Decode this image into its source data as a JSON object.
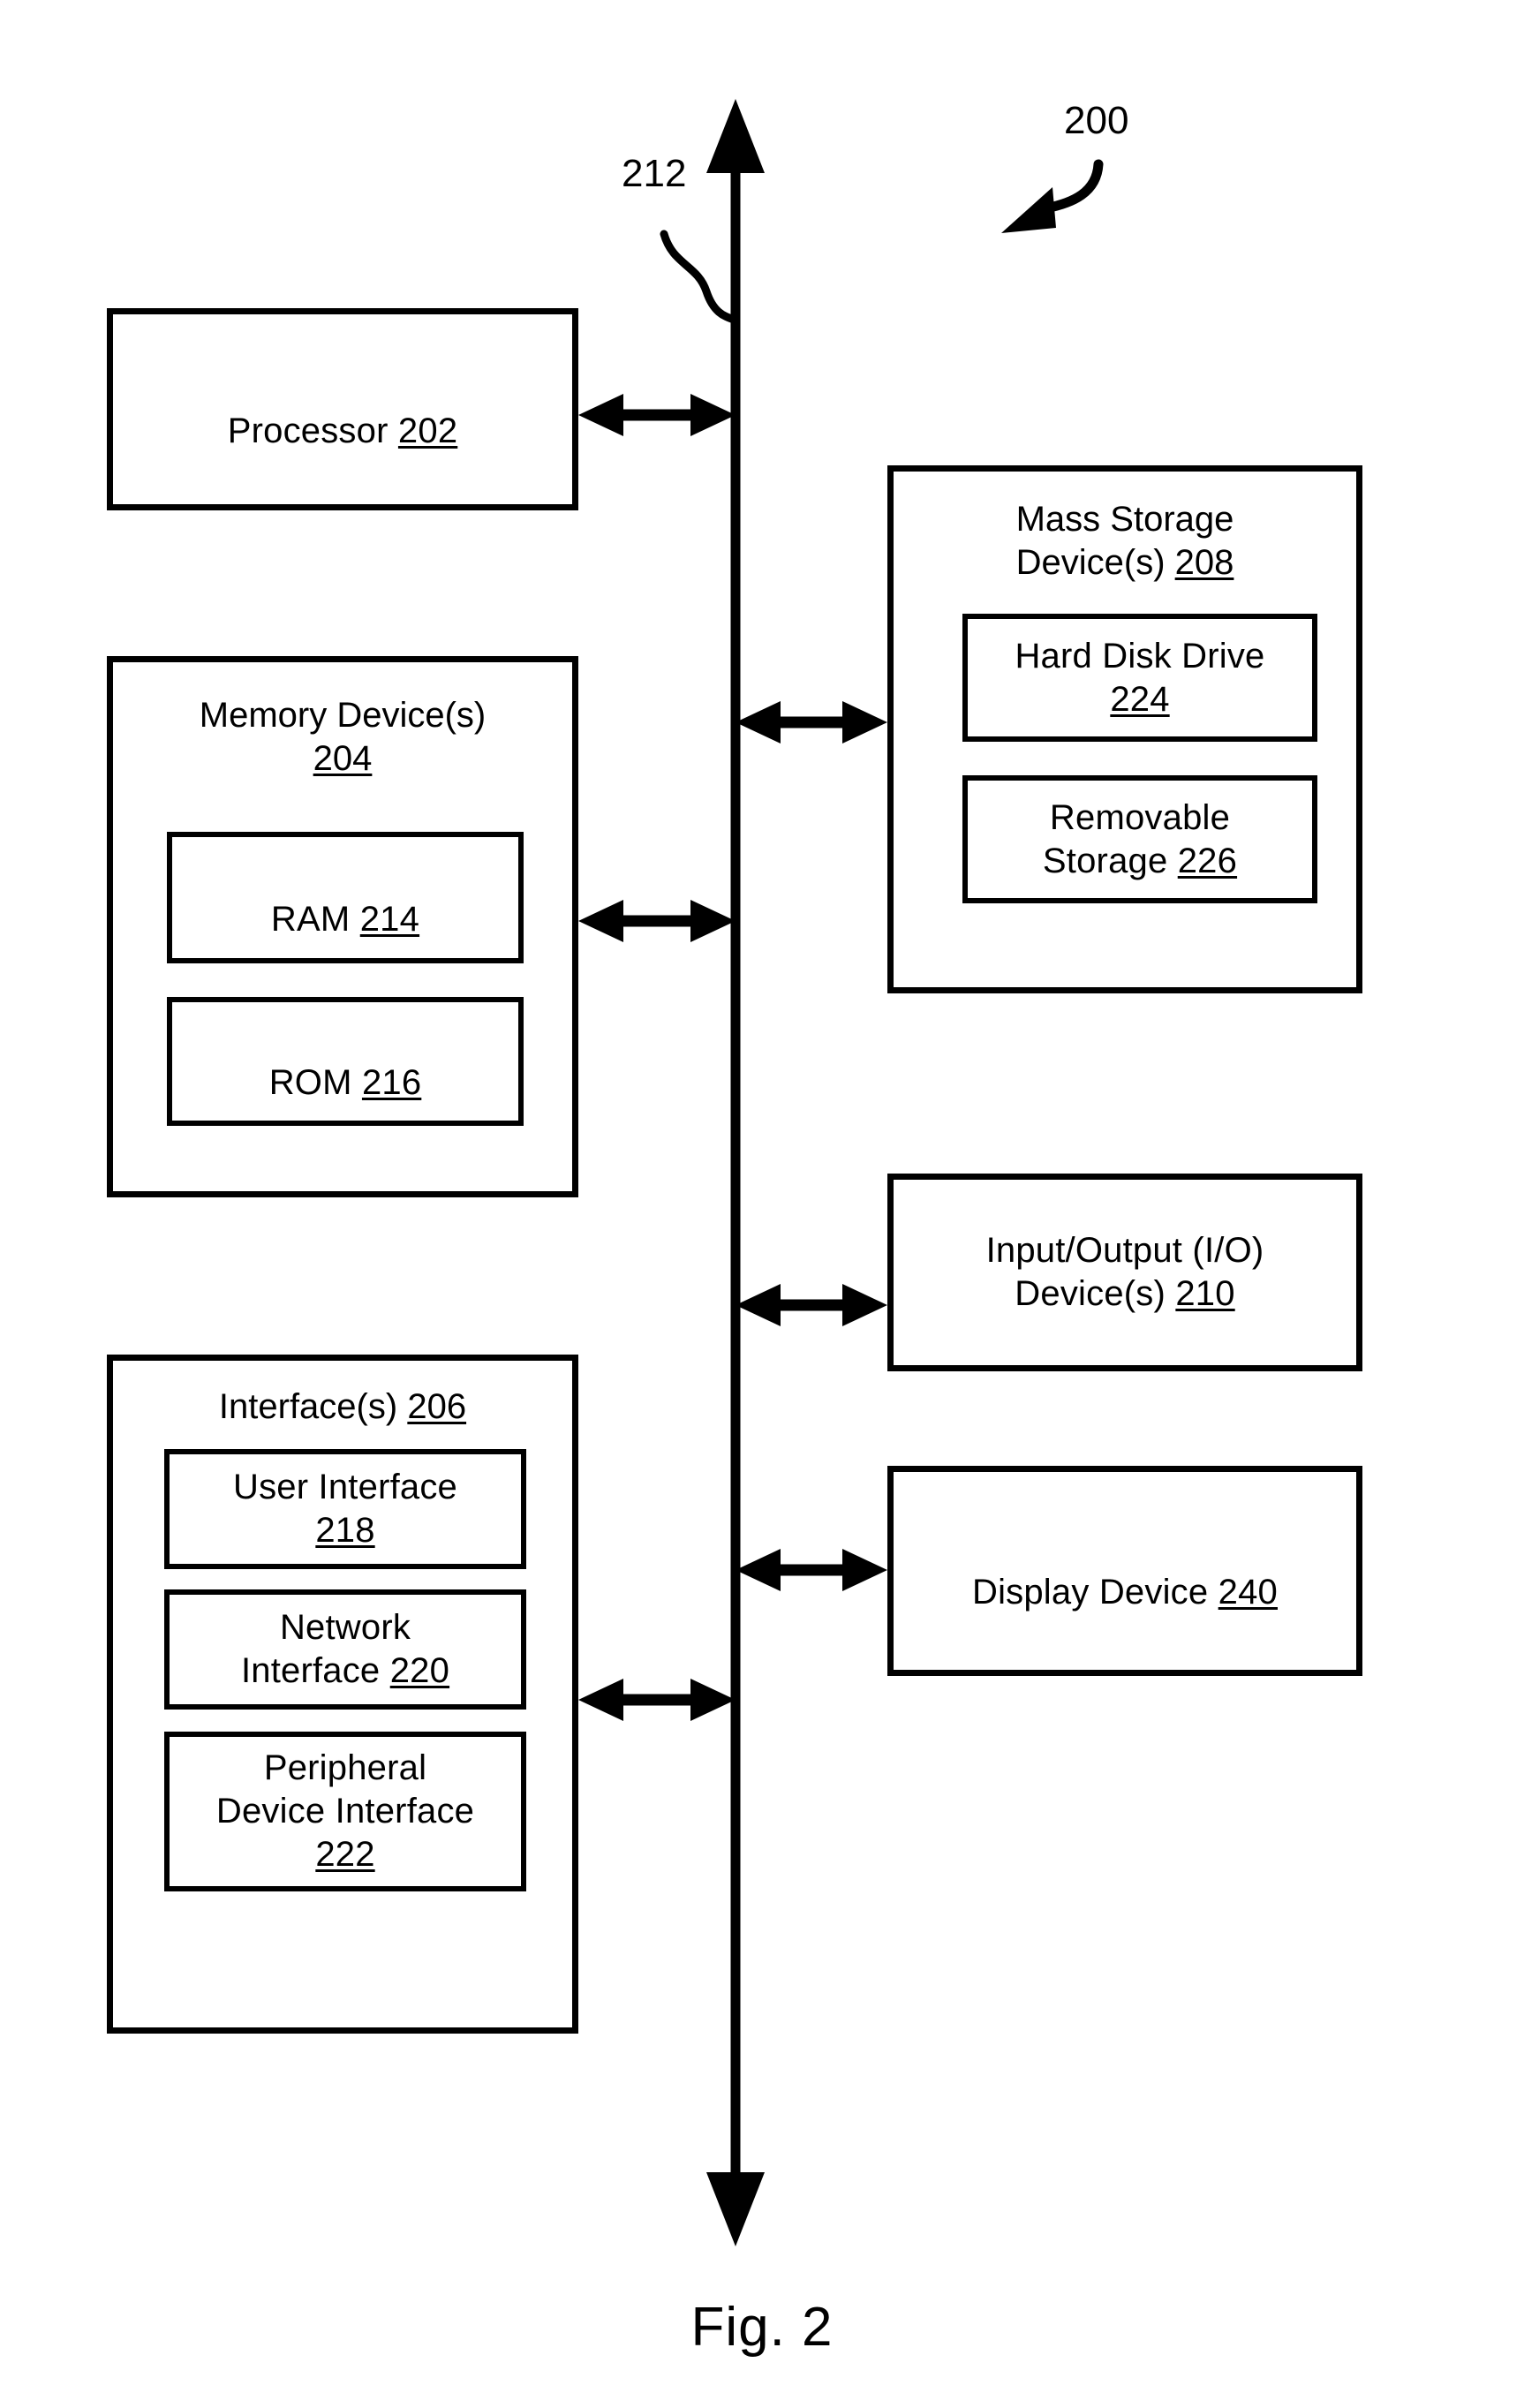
{
  "figure": {
    "caption": "Fig. 2",
    "system_ref": "200",
    "bus_ref": "212"
  },
  "left_column": [
    {
      "id": "processor",
      "name": "Processor",
      "ref": "202",
      "children": []
    },
    {
      "id": "memory-devices",
      "name": "Memory Device(s)",
      "ref": "204",
      "children": [
        {
          "id": "ram",
          "name": "RAM",
          "ref": "214"
        },
        {
          "id": "rom",
          "name": "ROM",
          "ref": "216"
        }
      ]
    },
    {
      "id": "interfaces",
      "name": "Interface(s)",
      "ref": "206",
      "children": [
        {
          "id": "user-interface",
          "name": "User Interface",
          "ref": "218"
        },
        {
          "id": "network-interface",
          "name": "Network\nInterface",
          "ref": "220"
        },
        {
          "id": "peripheral-device-interface",
          "name": "Peripheral\nDevice Interface",
          "ref": "222"
        }
      ]
    }
  ],
  "right_column": [
    {
      "id": "mass-storage-devices",
      "name": "Mass Storage\nDevice(s)",
      "ref": "208",
      "children": [
        {
          "id": "hard-disk-drive",
          "name": "Hard Disk Drive",
          "ref": "224"
        },
        {
          "id": "removable-storage",
          "name": "Removable\nStorage",
          "ref": "226"
        }
      ]
    },
    {
      "id": "io-devices",
      "name": "Input/Output (I/O)\nDevice(s)",
      "ref": "210",
      "children": []
    },
    {
      "id": "display-device",
      "name": "Display Device",
      "ref": "240",
      "children": []
    }
  ],
  "connectors": [
    {
      "id": "processor-to-bus",
      "from": "processor",
      "to": "bus",
      "style": "double-arrow"
    },
    {
      "id": "memory-to-bus",
      "from": "memory-devices",
      "to": "bus",
      "style": "double-arrow"
    },
    {
      "id": "interfaces-to-bus",
      "from": "interfaces",
      "to": "bus",
      "style": "double-arrow"
    },
    {
      "id": "bus-to-mass-storage",
      "from": "bus",
      "to": "mass-storage-devices",
      "style": "double-arrow"
    },
    {
      "id": "bus-to-io",
      "from": "bus",
      "to": "io-devices",
      "style": "double-arrow"
    },
    {
      "id": "bus-to-display",
      "from": "bus",
      "to": "display-device",
      "style": "double-arrow"
    }
  ],
  "colors": {
    "ink": "#000000",
    "paper": "#ffffff"
  }
}
